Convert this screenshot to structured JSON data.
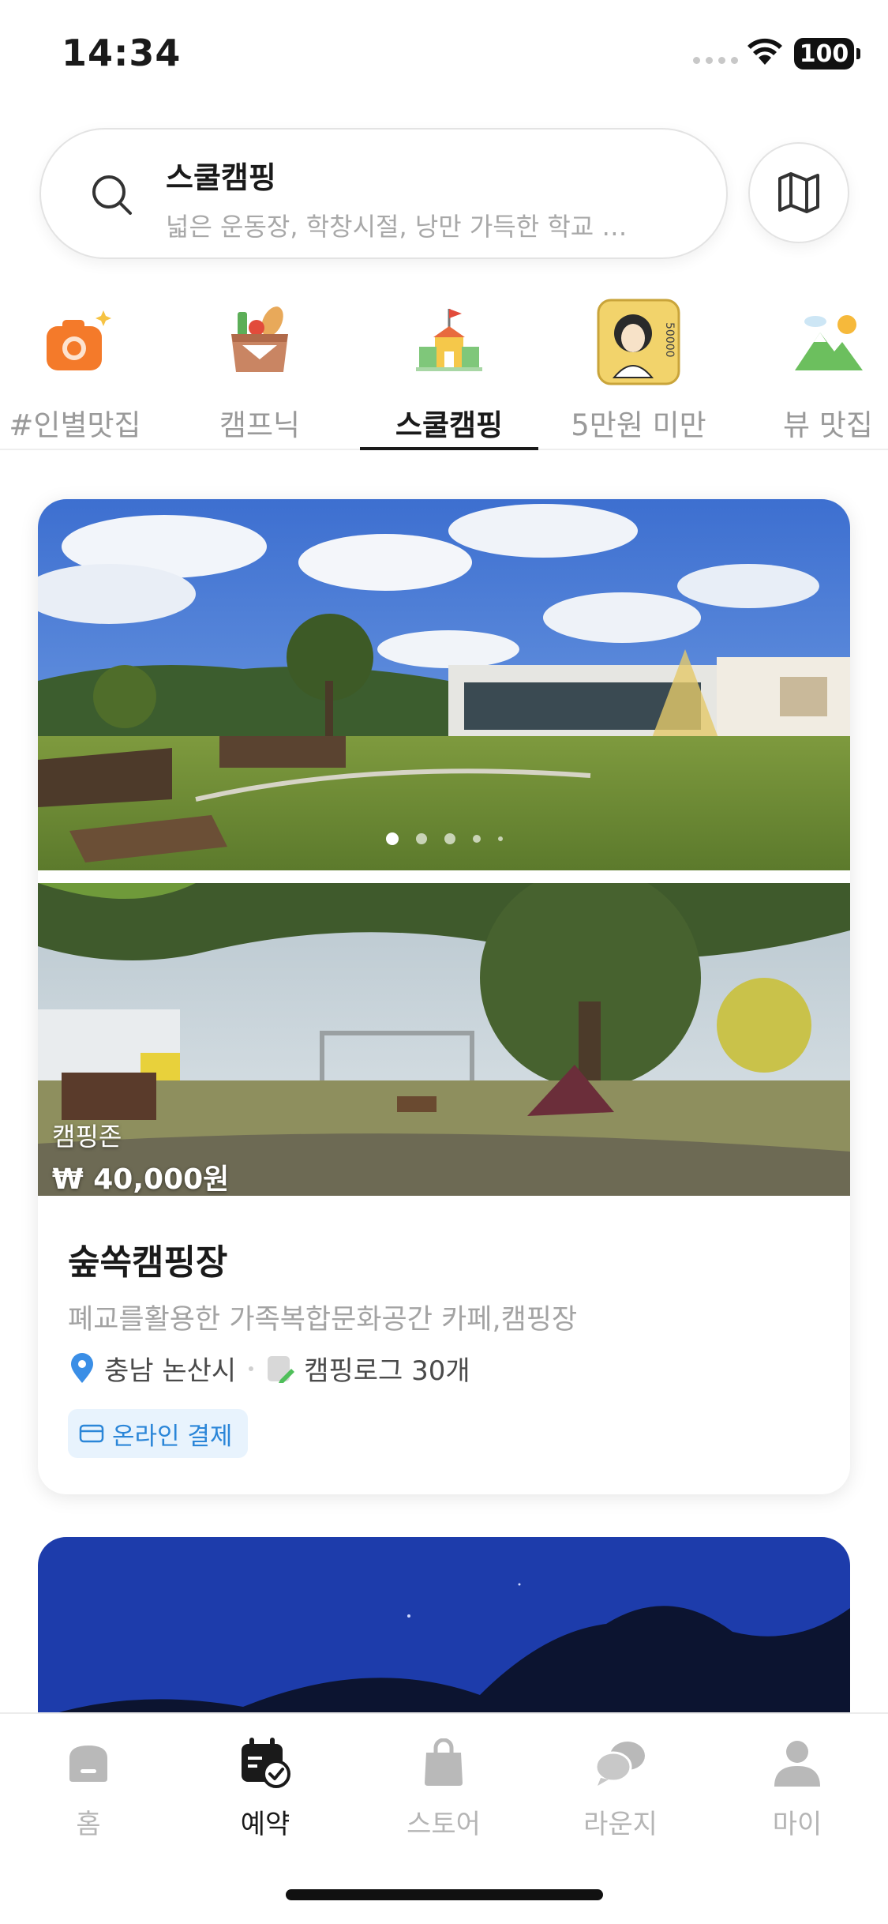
{
  "status_bar": {
    "time": "14:34",
    "battery": "100"
  },
  "search": {
    "title": "스쿨캠핑",
    "subtitle": "넓은 운동장, 학창시절, 낭만 가득한 학교 …"
  },
  "categories": [
    {
      "label": "#인별맛집",
      "icon": "camera-icon"
    },
    {
      "label": "캠프닉",
      "icon": "picnic-basket-icon"
    },
    {
      "label": "스쿨캠핑",
      "icon": "school-icon",
      "active": true
    },
    {
      "label": "5만원 미만",
      "icon": "banknote-50000-icon"
    },
    {
      "label": "뷰 맛집",
      "icon": "mountain-view-icon"
    }
  ],
  "card": {
    "zone_label": "캠핑존",
    "zone_price": "₩ 40,000원",
    "title": "숲쏙캠핑장",
    "description": "폐교를활용한 가족복합문화공간 카페,캠핑장",
    "location": "충남 논산시",
    "camping_log": "캠핑로그 30개",
    "payment_badge": "온라인 결제",
    "carousel_page": 1,
    "carousel_total": 5
  },
  "bottom_nav": [
    {
      "label": "홈",
      "icon": "home-icon"
    },
    {
      "label": "예약",
      "icon": "calendar-check-icon",
      "active": true
    },
    {
      "label": "스토어",
      "icon": "shopping-bag-icon"
    },
    {
      "label": "라운지",
      "icon": "chat-bubbles-icon"
    },
    {
      "label": "마이",
      "icon": "person-icon"
    }
  ],
  "colors": {
    "accent_blue": "#2b86d8",
    "badge_bg": "#e8f3fd",
    "inactive_gray": "#b5b5b5"
  }
}
